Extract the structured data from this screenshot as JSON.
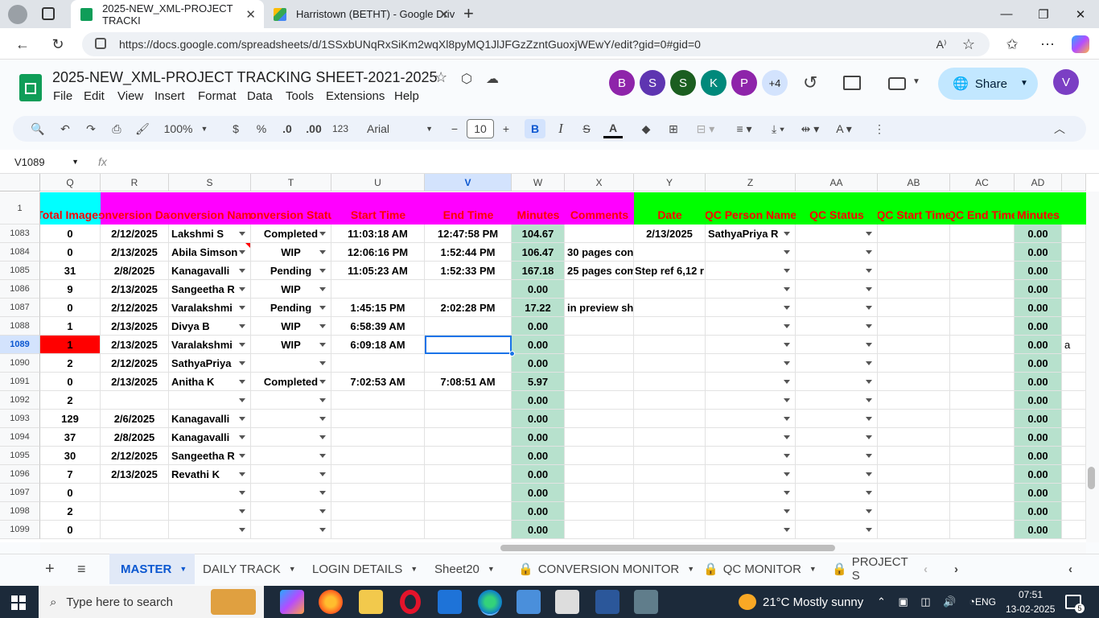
{
  "browser": {
    "tabs": [
      {
        "title": "2025-NEW_XML-PROJECT TRACKI",
        "active": true
      },
      {
        "title": "Harristown (BETHT) - Google Driv",
        "active": false
      }
    ],
    "url": "https://docs.google.com/spreadsheets/d/1SSxbUNqRxSiKm2wqXl8pyMQ1JlJFGzZzntGuoxjWEwY/edit?gid=0#gid=0"
  },
  "sheets": {
    "doc_title": "2025-NEW_XML-PROJECT TRACKING SHEET-2021-2025",
    "menus": [
      "File",
      "Edit",
      "View",
      "Insert",
      "Format",
      "Data",
      "Tools",
      "Extensions",
      "Help"
    ],
    "avatars": [
      {
        "letter": "B",
        "color": "#8e24aa"
      },
      {
        "letter": "S",
        "color": "#5e35b1"
      },
      {
        "letter": "S",
        "color": "#1b5e20"
      },
      {
        "letter": "K",
        "color": "#00897b"
      },
      {
        "letter": "P",
        "color": "#8e24aa"
      }
    ],
    "more_avatars": "+4",
    "share_label": "Share",
    "user_avatar": "V",
    "toolbar": {
      "zoom": "100%",
      "currency": "$",
      "percent": "%",
      "dec_decrease": ".0",
      "dec_increase": ".00",
      "format_123": "123",
      "font": "Arial",
      "font_size": "10"
    },
    "name_box": "V1089",
    "fx": "fx"
  },
  "grid": {
    "columns": [
      "Q",
      "R",
      "S",
      "T",
      "U",
      "V",
      "W",
      "X",
      "Y",
      "Z",
      "AA",
      "AB",
      "AC",
      "AD"
    ],
    "header_row_num": "1",
    "headers": [
      "Total Images",
      "Conversion Date",
      "Conversion Name",
      "Conversion Status",
      "Start Time",
      "End Time",
      "Minutes",
      "Comments",
      "Date",
      "QC Person Name",
      "QC Status",
      "QC Start Time",
      "QC End Time",
      "Minutes"
    ],
    "rows": [
      {
        "num": "1083",
        "q": "0",
        "r": "2/12/2025",
        "s": "Lakshmi S",
        "t": "Completed",
        "u": "11:03:18 AM",
        "v": "12:47:58 PM",
        "w": "104.67",
        "x": "",
        "y": "2/13/2025",
        "z": "SathyaPriya R",
        "ad": "0.00"
      },
      {
        "num": "1084",
        "q": "0",
        "r": "2/13/2025",
        "s": "Abila Simson",
        "t": "WIP",
        "u": "12:06:16 PM",
        "v": "1:52:44 PM",
        "w": "106.47",
        "x": "30 pages con",
        "y": "",
        "z": "",
        "ad": "0.00"
      },
      {
        "num": "1085",
        "q": "31",
        "r": "2/8/2025",
        "s": "Kanagavalli",
        "t": "Pending",
        "u": "11:05:23 AM",
        "v": "1:52:33 PM",
        "w": "167.18",
        "x": "25 pages com",
        "y": "Step ref 6,12 r",
        "z": "",
        "ad": "0.00"
      },
      {
        "num": "1086",
        "q": "9",
        "r": "2/13/2025",
        "s": "Sangeetha R",
        "t": "WIP",
        "u": "",
        "v": "",
        "w": "0.00",
        "x": "",
        "y": "",
        "z": "",
        "ad": "0.00"
      },
      {
        "num": "1087",
        "q": "0",
        "r": "2/12/2025",
        "s": "Varalakshmi",
        "t": "Pending",
        "u": "1:45:15 PM",
        "v": "2:02:28 PM",
        "w": "17.22",
        "x": "in preview sh",
        "y": "",
        "z": "",
        "ad": "0.00"
      },
      {
        "num": "1088",
        "q": "1",
        "r": "2/13/2025",
        "s": "Divya B",
        "t": "WIP",
        "u": "6:58:39 AM",
        "v": "",
        "w": "0.00",
        "x": "",
        "y": "",
        "z": "",
        "ad": "0.00"
      },
      {
        "num": "1089",
        "q": "1",
        "r": "2/13/2025",
        "s": "Varalakshmi",
        "t": "WIP",
        "u": "6:09:18 AM",
        "v": "",
        "w": "0.00",
        "x": "",
        "y": "",
        "z": "",
        "ad": "0.00",
        "ae": "a"
      },
      {
        "num": "1090",
        "q": "2",
        "r": "2/12/2025",
        "s": "SathyaPriya",
        "t": "",
        "u": "",
        "v": "",
        "w": "0.00",
        "x": "",
        "y": "",
        "z": "",
        "ad": "0.00"
      },
      {
        "num": "1091",
        "q": "0",
        "r": "2/13/2025",
        "s": "Anitha K",
        "t": "Completed",
        "u": "7:02:53 AM",
        "v": "7:08:51 AM",
        "w": "5.97",
        "x": "",
        "y": "",
        "z": "",
        "ad": "0.00"
      },
      {
        "num": "1092",
        "q": "2",
        "r": "",
        "s": "",
        "t": "",
        "u": "",
        "v": "",
        "w": "0.00",
        "x": "",
        "y": "",
        "z": "",
        "ad": "0.00"
      },
      {
        "num": "1093",
        "q": "129",
        "r": "2/6/2025",
        "s": "Kanagavalli",
        "t": "",
        "u": "",
        "v": "",
        "w": "0.00",
        "x": "",
        "y": "",
        "z": "",
        "ad": "0.00"
      },
      {
        "num": "1094",
        "q": "37",
        "r": "2/8/2025",
        "s": "Kanagavalli",
        "t": "",
        "u": "",
        "v": "",
        "w": "0.00",
        "x": "",
        "y": "",
        "z": "",
        "ad": "0.00"
      },
      {
        "num": "1095",
        "q": "30",
        "r": "2/12/2025",
        "s": "Sangeetha R",
        "t": "",
        "u": "",
        "v": "",
        "w": "0.00",
        "x": "",
        "y": "",
        "z": "",
        "ad": "0.00"
      },
      {
        "num": "1096",
        "q": "7",
        "r": "2/13/2025",
        "s": "Revathi K",
        "t": "",
        "u": "",
        "v": "",
        "w": "0.00",
        "x": "",
        "y": "",
        "z": "",
        "ad": "0.00"
      },
      {
        "num": "1097",
        "q": "0",
        "r": "",
        "s": "",
        "t": "",
        "u": "",
        "v": "",
        "w": "0.00",
        "x": "",
        "y": "",
        "z": "",
        "ad": "0.00"
      },
      {
        "num": "1098",
        "q": "2",
        "r": "",
        "s": "",
        "t": "",
        "u": "",
        "v": "",
        "w": "0.00",
        "x": "",
        "y": "",
        "z": "",
        "ad": "0.00"
      },
      {
        "num": "1099",
        "q": "0",
        "r": "",
        "s": "",
        "t": "",
        "u": "",
        "v": "",
        "w": "0.00",
        "x": "",
        "y": "",
        "z": "",
        "ad": "0.00"
      }
    ]
  },
  "sheet_tabs": [
    "MASTER",
    "DAILY TRACK",
    "LOGIN DETAILS",
    "Sheet20",
    "CONVERSION MONITOR",
    "QC MONITOR",
    "PROJECT S"
  ],
  "taskbar": {
    "search_placeholder": "Type here to search",
    "weather": "21°C  Mostly sunny",
    "lang": "ENG",
    "time": "07:51",
    "date": "13-02-2025",
    "notif_count": "5"
  },
  "colors": {
    "cyan_header": "#00ffff",
    "magenta_header": "#ff00ff",
    "green_header": "#00ff00",
    "minutes_fill": "#b7e1cd",
    "red_cell": "#ff0000"
  }
}
